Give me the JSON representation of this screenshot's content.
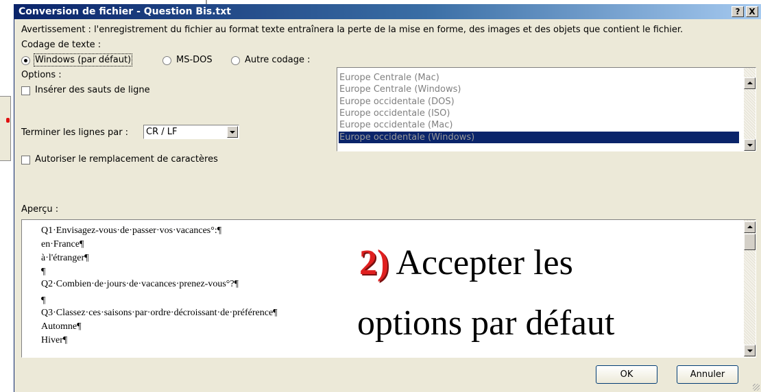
{
  "window": {
    "title": "Conversion de fichier - Question Bis.txt",
    "help_button": "?",
    "close_button": "X"
  },
  "warning_text": "Avertissement : l'enregistrement du fichier au format texte entraînera la perte de la mise en forme, des images et des objets que contient le fichier.",
  "encoding": {
    "label": "Codage de texte :",
    "options": [
      "Windows (par défaut)",
      "MS-DOS",
      "Autre codage :"
    ],
    "selected_index": 0,
    "list_items": [
      "Europe Centrale (Mac)",
      "Europe Centrale (Windows)",
      "Europe occidentale (DOS)",
      "Europe occidentale (ISO)",
      "Europe occidentale (Mac)",
      "Europe occidentale (Windows)"
    ],
    "list_selected": "Europe occidentale (Windows)"
  },
  "options": {
    "label": "Options :",
    "insert_breaks_label": "Insérer des sauts de ligne",
    "insert_breaks_checked": false,
    "end_lines_label": "Terminer les lignes par :",
    "end_lines_value": "CR / LF",
    "allow_substitution_label": "Autoriser le remplacement de caractères",
    "allow_substitution_checked": false
  },
  "preview": {
    "label": "Aperçu :",
    "lines": [
      "Q1·Envisagez-vous·de·passer·vos·vacances°:¶",
      "en·France¶",
      "à·l'étranger¶",
      "¶",
      "Q2·Combien·de·jours·de·vacances·prenez-vous°?¶",
      "¶",
      "Q3·Classez·ces·saisons·par·ordre·décroissant·de·préférence¶",
      "Automne¶",
      "Hiver¶"
    ]
  },
  "overlay": {
    "number": "2)",
    "line1": "Accepter les",
    "line2": "options par défaut"
  },
  "buttons": {
    "ok": "OK",
    "cancel": "Annuler"
  },
  "colors": {
    "title_bar": "#0a246a",
    "selection": "#0a246a",
    "overlay_number": "#e02020"
  }
}
